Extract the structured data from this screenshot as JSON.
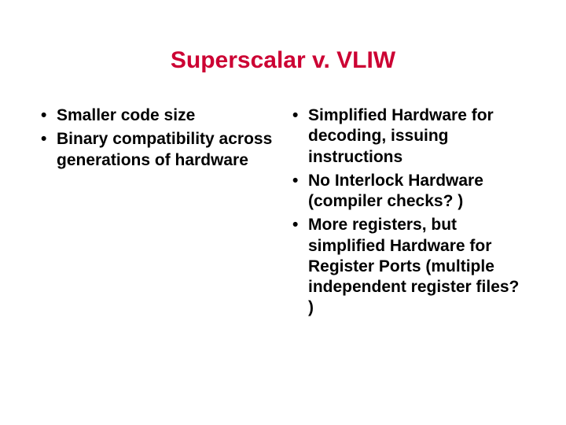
{
  "title": "Superscalar v. VLIW",
  "left": {
    "items": [
      "Smaller code size",
      "Binary compatibility across generations of hardware"
    ]
  },
  "right": {
    "items": [
      "Simplified Hardware for decoding, issuing instructions",
      "No Interlock Hardware (compiler checks? )",
      "More registers, but simplified Hardware for Register Ports (multiple independent register files? )"
    ]
  }
}
